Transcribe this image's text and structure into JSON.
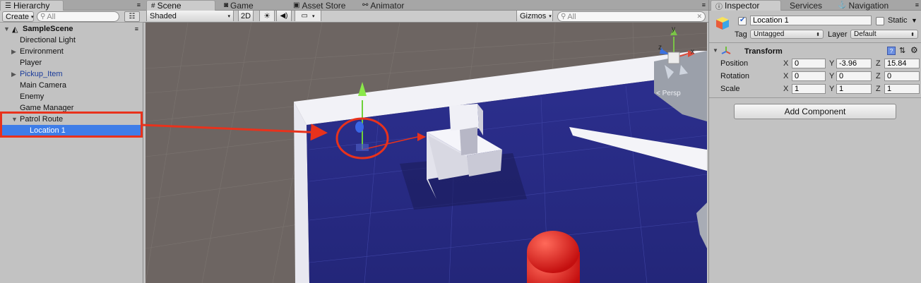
{
  "hierarchy": {
    "tab_title": "Hierarchy",
    "create_label": "Create",
    "search_placeholder": "All",
    "scene_name": "SampleScene",
    "items": [
      {
        "label": "Directional Light",
        "expandable": false,
        "indent": 1
      },
      {
        "label": "Environment",
        "expandable": true,
        "indent": 1
      },
      {
        "label": "Player",
        "expandable": false,
        "indent": 1
      },
      {
        "label": "Pickup_Item",
        "expandable": true,
        "indent": 1,
        "prefab": true
      },
      {
        "label": "Main Camera",
        "expandable": false,
        "indent": 1
      },
      {
        "label": "Enemy",
        "expandable": false,
        "indent": 1
      },
      {
        "label": "Game Manager",
        "expandable": false,
        "indent": 1
      },
      {
        "label": "Patrol Route",
        "expandable": true,
        "expanded": true,
        "indent": 1
      },
      {
        "label": "Location 1",
        "expandable": false,
        "indent": 2,
        "selected": true
      }
    ]
  },
  "tabs": {
    "scene": "Scene",
    "game": "Game",
    "asset_store": "Asset Store",
    "animator": "Animator"
  },
  "scene_toolbar": {
    "shading_mode": "Shaded",
    "mode_2d": "2D",
    "gizmos_label": "Gizmos",
    "search_placeholder": "All"
  },
  "viewport": {
    "persp_label": "< Persp",
    "gizmo_axes": {
      "y": "y",
      "x": "x",
      "z": "z"
    }
  },
  "inspector": {
    "tabs": {
      "inspector": "Inspector",
      "services": "Services",
      "navigation": "Navigation"
    },
    "object_name": "Location 1",
    "active": true,
    "static_label": "Static",
    "static_checked": false,
    "tag_label": "Tag",
    "tag_value": "Untagged",
    "layer_label": "Layer",
    "layer_value": "Default",
    "transform": {
      "title": "Transform",
      "position_label": "Position",
      "rotation_label": "Rotation",
      "scale_label": "Scale",
      "position": {
        "x": "0",
        "y": "-3.96",
        "z": "15.84"
      },
      "rotation": {
        "x": "0",
        "y": "0",
        "z": "0"
      },
      "scale": {
        "x": "1",
        "y": "1",
        "z": "1"
      }
    },
    "add_component_label": "Add Component"
  },
  "colors": {
    "selection": "#3e7de8",
    "annotation_red": "#e8321c",
    "floor_blue": "#2a2f8a",
    "prefab_text": "#1a3b9a"
  }
}
